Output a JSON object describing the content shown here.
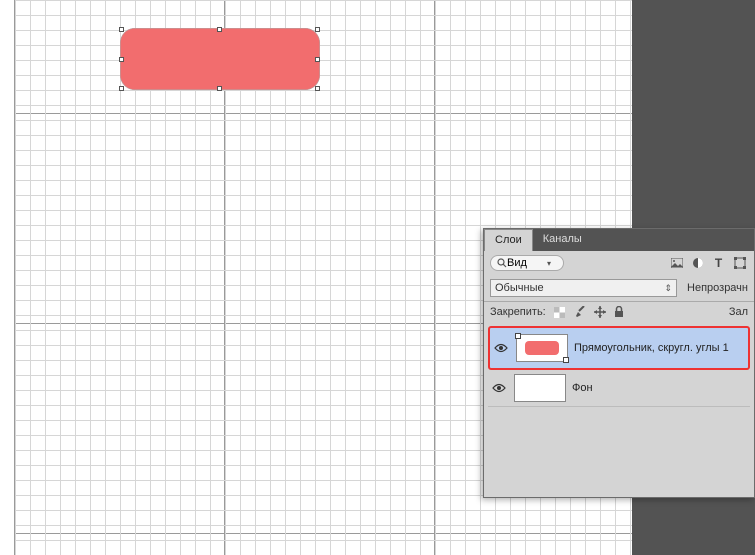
{
  "canvas": {
    "shape_color": "#f26d6e"
  },
  "panel": {
    "tabs": {
      "layers": "Слои",
      "channels": "Каналы"
    },
    "search_label": "Вид",
    "blend_mode": "Обычные",
    "opacity_label": "Непрозрачн",
    "lock_label": "Закрепить:",
    "fill_label": "Зал",
    "layers": [
      {
        "name": "Прямоугольник, скругл. углы 1",
        "selected": true
      },
      {
        "name": "Фон",
        "selected": false
      }
    ]
  }
}
